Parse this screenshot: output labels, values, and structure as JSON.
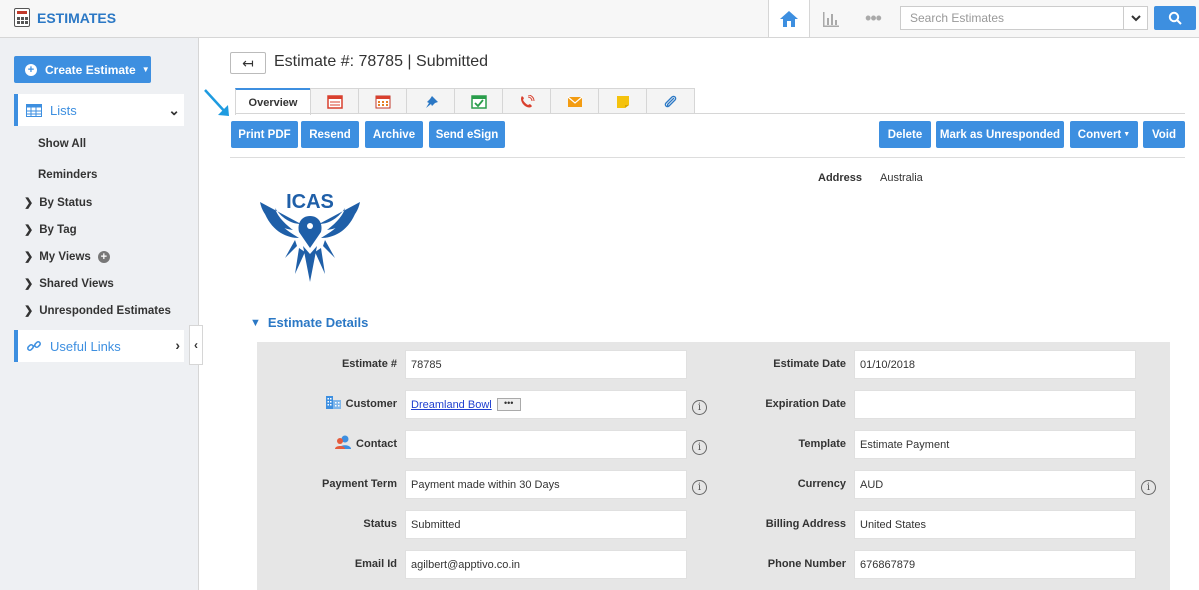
{
  "app": {
    "title": "ESTIMATES"
  },
  "header": {
    "search_placeholder": "Search Estimates"
  },
  "sidebar": {
    "create_label": "Create Estimate",
    "lists_label": "Lists",
    "show_all": "Show All",
    "reminders": "Reminders",
    "by_status": "By Status",
    "by_tag": "By Tag",
    "my_views": "My Views",
    "shared_views": "Shared Views",
    "unresponded": "Unresponded Estimates",
    "useful_links": "Useful Links"
  },
  "page": {
    "title": "Estimate #: 78785 | Submitted"
  },
  "tabs": {
    "overview": "Overview"
  },
  "actions": {
    "print_pdf": "Print PDF",
    "resend": "Resend",
    "archive": "Archive",
    "send_esign": "Send eSign",
    "delete": "Delete",
    "mark_unresponded": "Mark as Unresponded",
    "convert": "Convert",
    "void": "Void"
  },
  "address": {
    "label": "Address",
    "value": "Australia"
  },
  "logo_text": "ICAS",
  "section": {
    "title": "Estimate Details"
  },
  "fields": {
    "estimate_no": {
      "label": "Estimate #",
      "value": "78785"
    },
    "customer": {
      "label": "Customer",
      "value": "Dreamland Bowl"
    },
    "contact": {
      "label": "Contact",
      "value": ""
    },
    "payment_term": {
      "label": "Payment Term",
      "value": "Payment made within 30 Days"
    },
    "status": {
      "label": "Status",
      "value": "Submitted"
    },
    "email": {
      "label": "Email Id",
      "value": "agilbert@apptivo.co.in"
    },
    "estimate_date": {
      "label": "Estimate Date",
      "value": "01/10/2018"
    },
    "expiration_date": {
      "label": "Expiration Date",
      "value": ""
    },
    "template": {
      "label": "Template",
      "value": "Estimate Payment"
    },
    "currency": {
      "label": "Currency",
      "value": "AUD"
    },
    "billing_address": {
      "label": "Billing Address",
      "value": "United States"
    },
    "phone": {
      "label": "Phone Number",
      "value": "676867879"
    }
  },
  "colors": {
    "accent": "#3d8fe0",
    "title_blue": "#2b78c5"
  }
}
